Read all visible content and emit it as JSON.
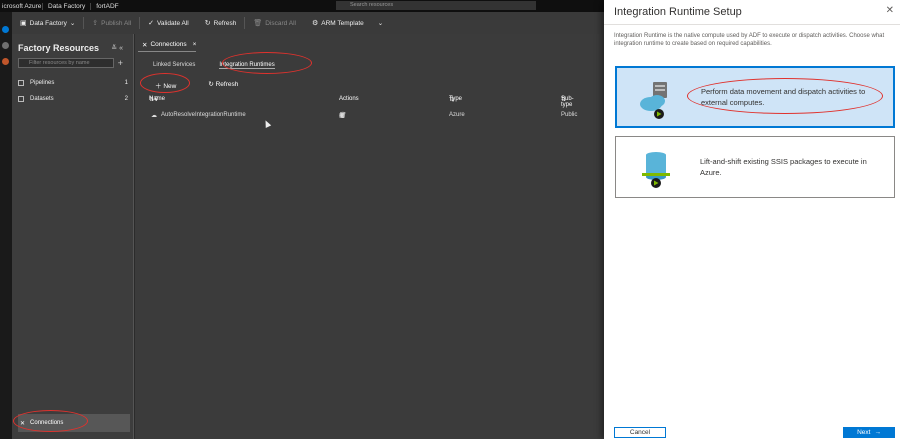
{
  "topbar": {
    "brand": "icrosoft Azure",
    "crumb1": "Data Factory",
    "crumb2": "fortADF",
    "search_placeholder": "Search resources"
  },
  "toolbar": {
    "items": [
      {
        "label": "Data Factory",
        "icon": "factory-icon",
        "dim": false
      },
      {
        "label": "Publish All",
        "icon": "upload-icon",
        "dim": true
      },
      {
        "label": "Validate All",
        "icon": "check-icon",
        "dim": false
      },
      {
        "label": "Refresh",
        "icon": "refresh-icon",
        "dim": false
      },
      {
        "label": "Discard All",
        "icon": "trash-icon",
        "dim": true
      },
      {
        "label": "ARM Template",
        "icon": "arm-icon",
        "dim": false
      }
    ]
  },
  "factory": {
    "title": "Factory Resources",
    "filter_placeholder": "Filter resources by name",
    "items": [
      {
        "label": "Pipelines",
        "count": "1"
      },
      {
        "label": "Datasets",
        "count": "2"
      }
    ],
    "connections_label": "Connections"
  },
  "main": {
    "tab_label": "Connections",
    "subtabs": [
      "Linked Services",
      "Integration Runtimes"
    ],
    "new_label": "New",
    "refresh_label": "Refresh",
    "columns": {
      "name": "Name",
      "actions": "Actions",
      "type": "Type",
      "subtype": "Sub-type"
    },
    "rows": [
      {
        "name": "AutoResolveIntegrationRuntime",
        "type": "Azure",
        "subtype": "Public"
      }
    ]
  },
  "panel": {
    "title": "Integration Runtime Setup",
    "description": "Integration Runtime is the native compute used by ADF to execute or dispatch activities. Choose what integration runtime to create based on required capabilities.",
    "options": [
      {
        "text": "Perform data movement and dispatch activities to external computes.",
        "selected": true,
        "icon": "cloud-server-icon"
      },
      {
        "text": "Lift-and-shift existing SSIS packages to execute in Azure.",
        "selected": false,
        "icon": "ssis-database-icon"
      }
    ],
    "cancel_label": "Cancel",
    "next_label": "Next"
  },
  "colors": {
    "accent": "#0078d4",
    "highlight_ellipse": "#e0322d",
    "selected_card_bg": "#cfe4f7"
  }
}
